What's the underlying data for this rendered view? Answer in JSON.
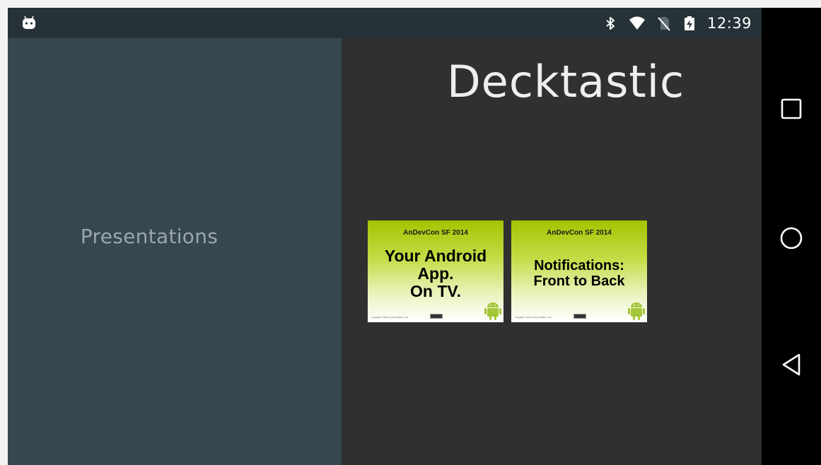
{
  "status_bar": {
    "time": "12:39",
    "left_icon": "android-head-icon",
    "right_icons": [
      "bluetooth-icon",
      "wifi-icon",
      "no-sim-icon",
      "battery-charging-icon"
    ]
  },
  "left_pane": {
    "label": "Presentations"
  },
  "right_pane": {
    "title": "Decktastic",
    "presentations": [
      {
        "conference": "AnDevCon SF 2014",
        "title": "Your Android\nApp.\nOn TV.",
        "copyright": "Copyright © 2014 CommonsWare, LLC"
      },
      {
        "conference": "AnDevCon SF 2014",
        "title": "Notifications:\nFront to Back",
        "copyright": "Copyright © 2014 CommonsWare, LLC"
      }
    ]
  },
  "nav_bar": {
    "buttons": [
      "recents-icon",
      "home-icon",
      "back-icon"
    ]
  },
  "colors": {
    "status_bar": "#263238",
    "left_pane": "#37474f",
    "right_pane": "#303030",
    "nav_bar": "#000000",
    "card_green": "#a4c400",
    "android_green": "#a4c639"
  }
}
